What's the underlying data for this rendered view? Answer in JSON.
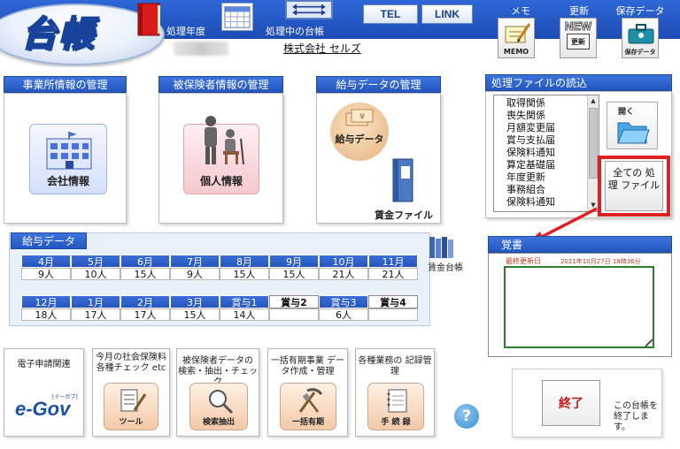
{
  "app": {
    "logo": "台帳"
  },
  "header": {
    "fiscal_year_label": "処理年度",
    "current_ledger_label": "処理中の台帳",
    "company_name": "株式会社 セルズ",
    "tel_label": "TEL",
    "link_label": "LINK",
    "memo_label": "メモ",
    "memo_icon_text": "MEMO",
    "update_label": "更新",
    "update_badge": "NEW",
    "update_icon_text": "更新",
    "save_label": "保存データ",
    "save_icon_text": "保存データ"
  },
  "office": {
    "title": "事業所情報の管理",
    "button_label": "会社情報"
  },
  "insured": {
    "title": "被保険者情報の管理",
    "button_label": "個人情報"
  },
  "salary_mgmt": {
    "title": "給与データの管理",
    "salary_label": "給与データ",
    "wage_file_label": "賃金ファイル"
  },
  "file_read": {
    "title": "処理ファイルの読込",
    "items": [
      "取得関係",
      "喪失関係",
      "月額変更届",
      "賞与支払届",
      "保険料通知",
      "算定基礎届",
      "年度更新",
      "事務組合",
      "保険料通知"
    ],
    "open_label": "開く",
    "all_files_label": "全ての 処　理 ファイル"
  },
  "salary_data": {
    "title": "給与データ",
    "ledger_label": "賃金台帳",
    "row1_headers": [
      "4月",
      "5月",
      "6月",
      "7月",
      "8月",
      "9月",
      "10月",
      "11月"
    ],
    "row1_counts": [
      "9人",
      "10人",
      "15人",
      "9人",
      "15人",
      "15人",
      "21人",
      "21人"
    ],
    "row2_headers": [
      "12月",
      "1月",
      "2月",
      "3月",
      "賞与1",
      "賞与2",
      "賞与3",
      "賞与4"
    ],
    "row2_counts": [
      "18人",
      "17人",
      "17人",
      "15人",
      "14人",
      "",
      "6人",
      ""
    ]
  },
  "memo": {
    "title": "覚書",
    "last_updated_label": "最終更新日",
    "last_updated_value": "2021年10月27日 18時36分"
  },
  "bottom": {
    "egov": {
      "title": "電子申請関連",
      "logo_main": "e-Gov",
      "logo_sub": "[イーガブ]"
    },
    "check": {
      "title": "今月の社会保険料 各種チェック etc",
      "icon_label": "ツール"
    },
    "search": {
      "title": "被保険者データの 検索・抽出・チェック",
      "icon_label": "検索抽出"
    },
    "bulk": {
      "title": "一括有期事業 データ作成・管理",
      "icon_label": "一括有期"
    },
    "record": {
      "title": "各種業務の 記録管理",
      "icon_label": "手 続 録"
    },
    "help_symbol": "?"
  },
  "exit": {
    "button_label": "終了",
    "note": "この台帳を 終了します。"
  },
  "colors": {
    "header_blue": "#2458c6",
    "highlight_red": "#e02020",
    "memo_green": "#2f7d2f"
  }
}
